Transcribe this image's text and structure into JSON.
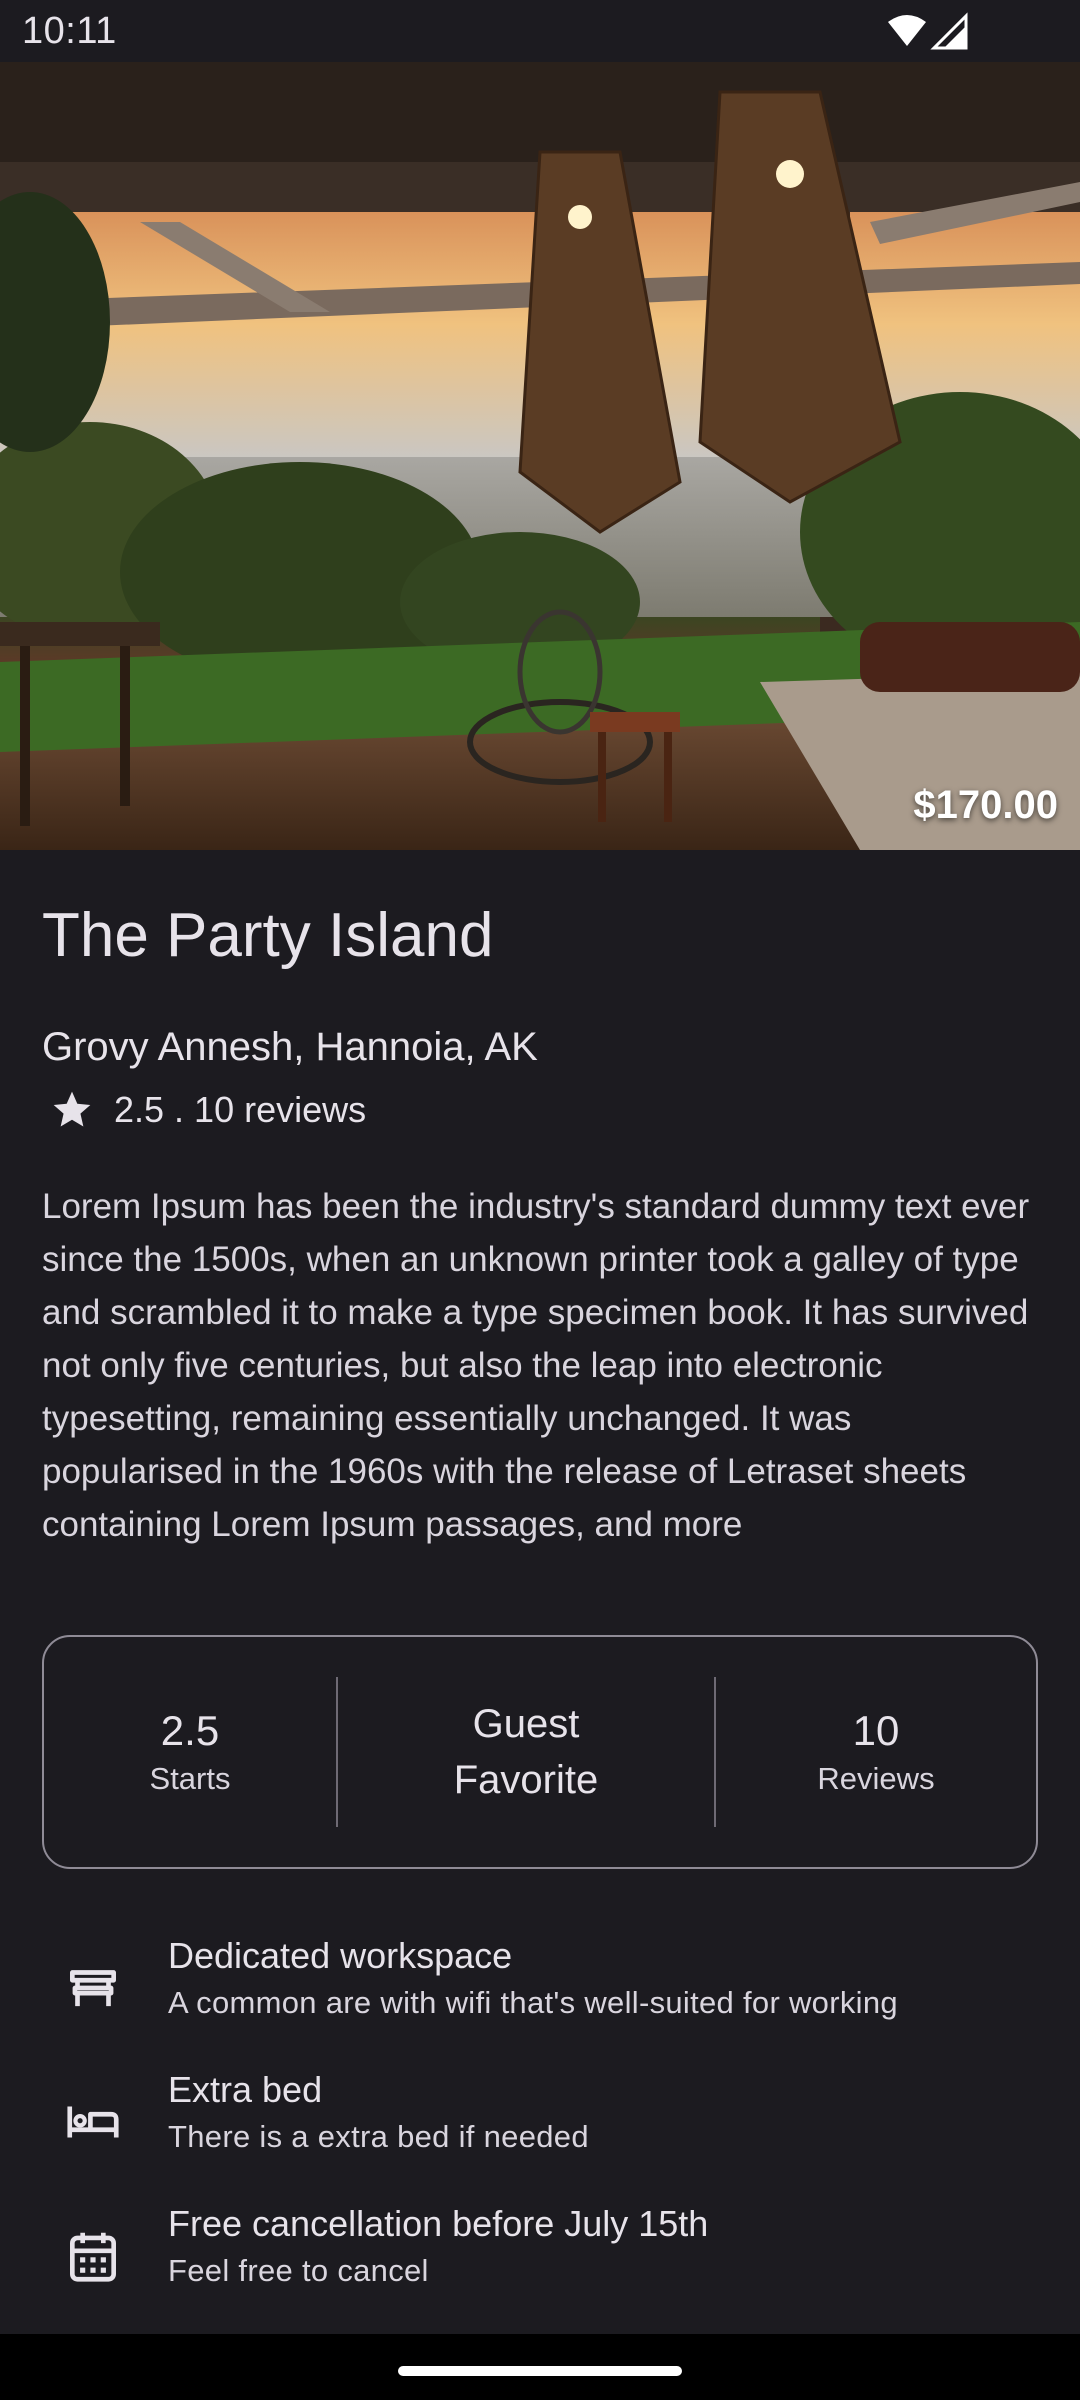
{
  "status_bar": {
    "time": "10:11"
  },
  "listing": {
    "price": "$170.00",
    "title": "The Party Island",
    "location": "Grovy Annesh, Hannoia, AK",
    "rating_text": "2.5 . 10 reviews",
    "description": "Lorem Ipsum has been the industry's standard dummy text ever since the 1500s, when an unknown printer took a galley of type and scrambled it to make a type specimen book. It has survived not only five centuries, but also the leap into electronic typesetting, remaining essentially unchanged. It was popularised in the 1960s with the release of Letraset sheets containing Lorem Ipsum passages, and more"
  },
  "stats": {
    "rating_value": "2.5",
    "rating_label": "Starts",
    "guest_line1": "Guest",
    "guest_line2": "Favorite",
    "reviews_value": "10",
    "reviews_label": "Reviews"
  },
  "amenities": [
    {
      "icon": "chair-icon",
      "title": "Dedicated workspace",
      "subtitle": "A common are with wifi that's well-suited for working"
    },
    {
      "icon": "bed-icon",
      "title": "Extra bed",
      "subtitle": "There is a extra bed if needed"
    },
    {
      "icon": "calendar-icon",
      "title": "Free cancellation before July 15th",
      "subtitle": "Feel free to cancel"
    }
  ]
}
